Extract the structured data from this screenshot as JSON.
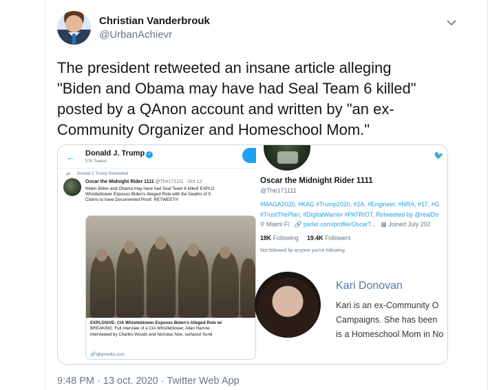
{
  "author": {
    "name": "Christian Vanderbrouk",
    "handle": "@UrbanAchievr"
  },
  "tweet": {
    "text": "The president retweeted an insane article alleging\n\"Biden and Obama may have had Seal Team 6 killed\"\nposted by a QAnon account and written by \"an ex-\nCommunity Organizer and Homeschool Mom.\"",
    "timestamp": "9:48 PM · 13 oct. 2020 · Twitter Web App"
  },
  "media": {
    "left": {
      "profile_name": "Donald J. Trump",
      "tweet_count": "57K Tweets",
      "retweeted_by": "Donald J. Trump Retweeted",
      "author_name": "Oscar the Midnight Rider 1111",
      "author_meta": "@The171111 · Oct 12",
      "body": "Hiden Biden and Obama may have had Seal Team 6 killed! EXPLO\nWhistleblower Exposes Biden's Alleged Role with the Deaths of S\nClaims to have Documented Proof. RETWEET!!!",
      "caption_title": "EXPLOSIVE: CIA Whistleblower Exposes Biden's Alleged Role wi",
      "caption_body": "BREAKING: Full interview of a CIA Whistleblower, Allan Harrow\ninterviewed by Charles Woods and Nicholas Noe, surfaced Sund",
      "domain": "djhjmedia.com"
    },
    "right_top": {
      "name": "Oscar the Midnight Rider 1111",
      "handle": "@The171111",
      "tags": "#MAGA2020, #KAG #Trump2020, #2A, #Engineer, #NRA, #17, #G\n#TrustThePlan, #DigitalWarrior #PATRIOT, Retweeted by @realDo",
      "location": "Miami Fl",
      "link": "parler.com/profile/OscarT...",
      "joined": "Joined July 202",
      "following_count": "18K",
      "following_label": "Following",
      "followers_count": "19.4K",
      "followers_label": "Followers",
      "not_followed": "Not followed by anyone you're following"
    },
    "right_bottom": {
      "name": "Kari Donovan",
      "bio": "Kari is an ex-Community O\nCampaigns. She has been\nis a Homeschool Mom in No"
    }
  },
  "icons": {
    "chevron": "chevron-down-icon",
    "verified": "verified-badge-icon",
    "retweet": "retweet-icon",
    "location": "location-pin-icon",
    "link": "link-icon",
    "calendar": "calendar-icon",
    "twitter": "twitter-bird-icon"
  },
  "colors": {
    "accent": "#1da1f2",
    "secondary_text": "#657786",
    "border": "#ccd6dd"
  }
}
